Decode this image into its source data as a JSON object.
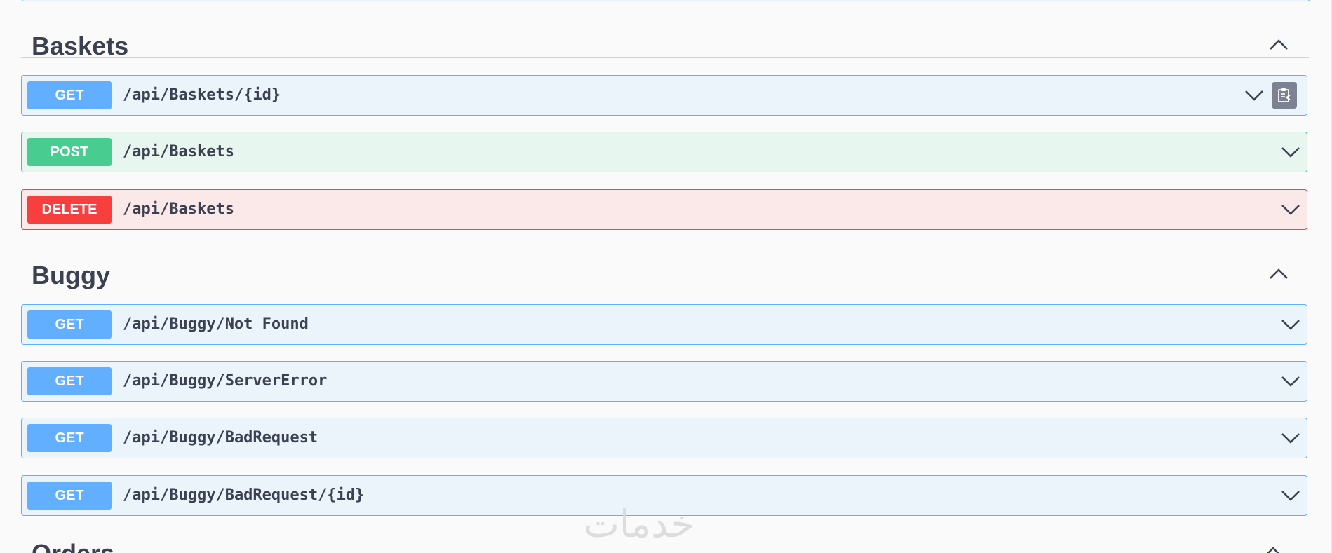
{
  "sections": [
    {
      "title": "Baskets",
      "operations": [
        {
          "method": "GET",
          "path": "/api/Baskets/{id}"
        },
        {
          "method": "POST",
          "path": "/api/Baskets"
        },
        {
          "method": "DELETE",
          "path": "/api/Baskets"
        }
      ]
    },
    {
      "title": "Buggy",
      "operations": [
        {
          "method": "GET",
          "path": "/api/Buggy/Not Found"
        },
        {
          "method": "GET",
          "path": "/api/Buggy/ServerError"
        },
        {
          "method": "GET",
          "path": "/api/Buggy/BadRequest"
        },
        {
          "method": "GET",
          "path": "/api/Buggy/BadRequest/{id}"
        }
      ]
    }
  ],
  "next_section": {
    "title": "Orders"
  },
  "watermark": "خدمات",
  "icons": {
    "collapse": "chevron-up-icon",
    "expand": "chevron-down-icon",
    "copy": "clipboard-copy-icon"
  },
  "colors": {
    "get": "#61affe",
    "post": "#49cc90",
    "delete": "#f93e3e",
    "text": "#3b4151"
  }
}
